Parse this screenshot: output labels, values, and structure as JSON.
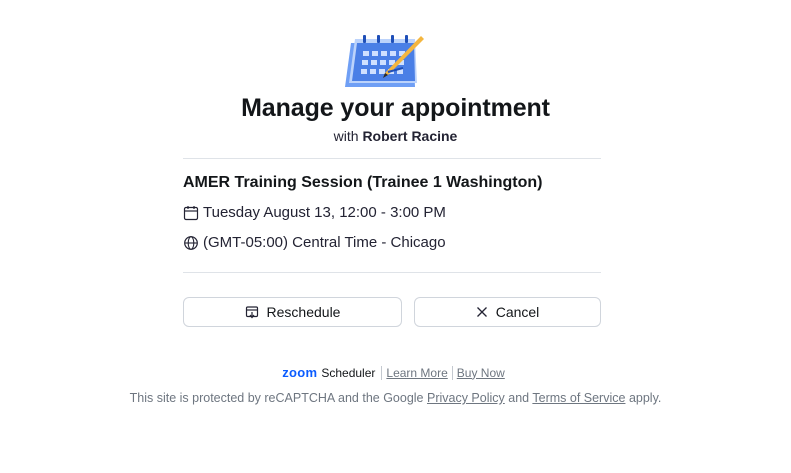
{
  "header": {
    "title": "Manage your appointment",
    "with_prefix": "with",
    "host_name": "Robert Racine",
    "illustration_icon": "calendar-pencil-icon"
  },
  "event": {
    "title": "AMER Training Session (Trainee 1 Washington)",
    "datetime": "Tuesday August 13, 12:00 - 3:00 PM",
    "timezone": "(GMT-05:00) Central Time - Chicago"
  },
  "actions": {
    "reschedule_label": "Reschedule",
    "cancel_label": "Cancel"
  },
  "footer": {
    "brand_logo": "zoom",
    "brand_product": "Scheduler",
    "learn_more": "Learn More",
    "buy_now": "Buy Now",
    "recaptcha_prefix": "This site is protected by reCAPTCHA and the Google",
    "privacy_policy": "Privacy Policy",
    "and_word": "and",
    "terms_of_service": "Terms of Service",
    "recaptcha_suffix": "apply."
  },
  "colors": {
    "brand_blue": "#0b5cff",
    "text": "#131619",
    "muted": "#6e7680",
    "divider": "#dfe3e8"
  }
}
